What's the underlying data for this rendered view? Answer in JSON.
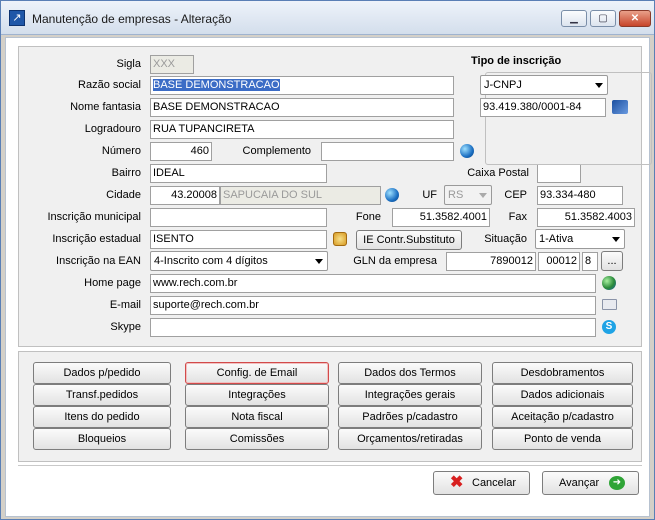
{
  "window": {
    "title": "Manutenção de empresas - Alteração",
    "min_icon": "minimize-icon",
    "max_icon": "maximize-icon",
    "close_icon": "close-icon"
  },
  "form": {
    "sigla": {
      "label": "Sigla",
      "value": "XXX"
    },
    "razao_social": {
      "label": "Razão social",
      "value": "BASE DEMONSTRACAO"
    },
    "nome_fantasia": {
      "label": "Nome fantasia",
      "value": "BASE DEMONSTRACAO"
    },
    "logradouro": {
      "label": "Logradouro",
      "value": "RUA TUPANCIRETA"
    },
    "numero": {
      "label": "Número",
      "value": "460"
    },
    "complemento": {
      "label": "Complemento",
      "value": ""
    },
    "bairro": {
      "label": "Bairro",
      "value": "IDEAL"
    },
    "caixa_postal": {
      "label": "Caixa Postal",
      "value": ""
    },
    "cidade": {
      "label": "Cidade",
      "code": "43.20008",
      "name": "SAPUCAIA DO SUL"
    },
    "uf": {
      "label": "UF",
      "value": "RS"
    },
    "cep": {
      "label": "CEP",
      "value": "93.334-480"
    },
    "inscricao_municipal": {
      "label": "Inscrição municipal",
      "value": ""
    },
    "fone": {
      "label": "Fone",
      "value": "51.3582.4001"
    },
    "fax": {
      "label": "Fax",
      "value": "51.3582.4003"
    },
    "inscricao_estadual": {
      "label": "Inscrição estadual",
      "value": "ISENTO"
    },
    "ie_button": "IE Contr.Substituto",
    "situacao": {
      "label": "Situação",
      "value": "1-Ativa"
    },
    "inscricao_ean": {
      "label": "Inscrição na EAN",
      "value": "4-Inscrito com 4 dígitos"
    },
    "gln": {
      "label": "GLN da empresa",
      "part1": "7890012",
      "part2": "00012",
      "part3": "8",
      "button": "..."
    },
    "home_page": {
      "label": "Home page",
      "value": "www.rech.com.br"
    },
    "email": {
      "label": "E-mail",
      "value": "suporte@rech.com.br"
    },
    "skype": {
      "label": "Skype",
      "value": ""
    },
    "tipo_inscricao": {
      "title": "Tipo de inscrição",
      "tipo": "J-CNPJ",
      "numero": "93.419.380/0001-84"
    }
  },
  "buttons": [
    [
      "Dados p/pedido",
      "Config. de Email",
      "Dados dos Termos",
      "Desdobramentos"
    ],
    [
      "Transf.pedidos",
      "Integrações",
      "Integrações gerais",
      "Dados adicionais"
    ],
    [
      "Itens do pedido",
      "Nota fiscal",
      "Padrões p/cadastro",
      "Aceitação p/cadastro"
    ],
    [
      "Bloqueios",
      "Comissões",
      "Orçamentos/retiradas",
      "Ponto de venda"
    ]
  ],
  "footer": {
    "cancel": "Cancelar",
    "next": "Avançar"
  }
}
